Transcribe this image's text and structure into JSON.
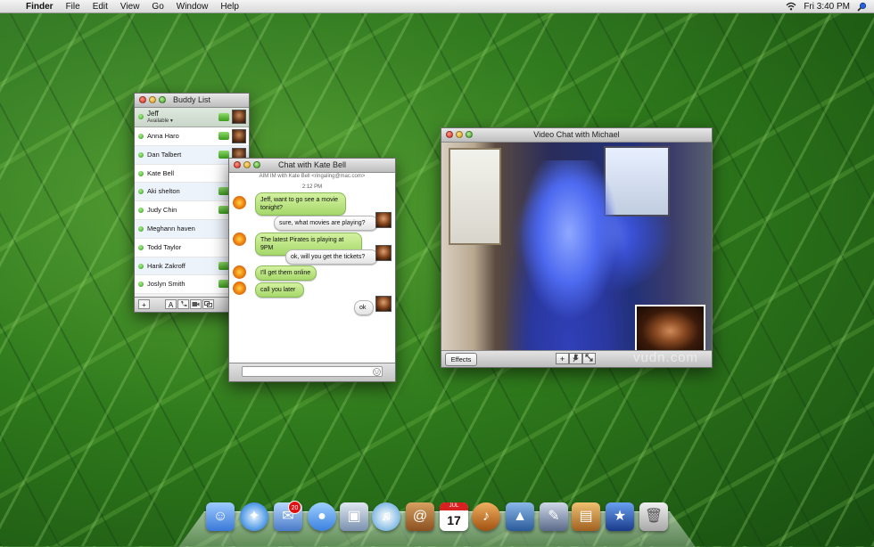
{
  "menubar": {
    "apple_glyph": "",
    "app": "Finder",
    "items": [
      "File",
      "Edit",
      "View",
      "Go",
      "Window",
      "Help"
    ],
    "clock": "Fri 3:40 PM"
  },
  "buddy_list": {
    "title": "Buddy List",
    "me": {
      "name": "Jeff",
      "status": "Available ▾"
    },
    "buddies": [
      {
        "name": "Anna Haro"
      },
      {
        "name": "Dan Talbert"
      },
      {
        "name": "Kate Bell"
      },
      {
        "name": "Aki shelton"
      },
      {
        "name": "Judy Chin"
      },
      {
        "name": "Meghann haven"
      },
      {
        "name": "Todd Taylor"
      },
      {
        "name": "Hank Zakroff"
      },
      {
        "name": "Joslyn Smith"
      }
    ],
    "toolbar": {
      "add": "+",
      "text": "A"
    }
  },
  "chat": {
    "title": "Chat with Kate Bell",
    "subtitle": "AIM IM with Kate Bell <ringaling@mac.com>",
    "time": "2:12 PM",
    "messages": [
      {
        "from": "them",
        "text": "Jeff, want to go see a movie tonight?"
      },
      {
        "from": "me",
        "text": "sure, what movies are playing?"
      },
      {
        "from": "them",
        "text": "The latest Pirates is playing at 9PM"
      },
      {
        "from": "me",
        "text": "ok, will you get the tickets?"
      },
      {
        "from": "them",
        "text": "I'll get them online"
      },
      {
        "from": "them",
        "text": "call you later"
      },
      {
        "from": "me",
        "text": "ok"
      }
    ]
  },
  "video": {
    "title": "Video Chat with Michael",
    "effects_label": "Effects",
    "add_label": "+"
  },
  "watermark": "vudn.com",
  "dock": {
    "items": [
      "Finder",
      "Safari",
      "Mail",
      "iChat",
      "Preview",
      "iTunes",
      "Address Book",
      "iCal",
      "GarageBand",
      "Keynote",
      "Xcode",
      "iPhoto",
      "iMovie",
      "Trash"
    ],
    "mail_badge": "20",
    "ical_day": "17",
    "ical_month": "JUL"
  }
}
